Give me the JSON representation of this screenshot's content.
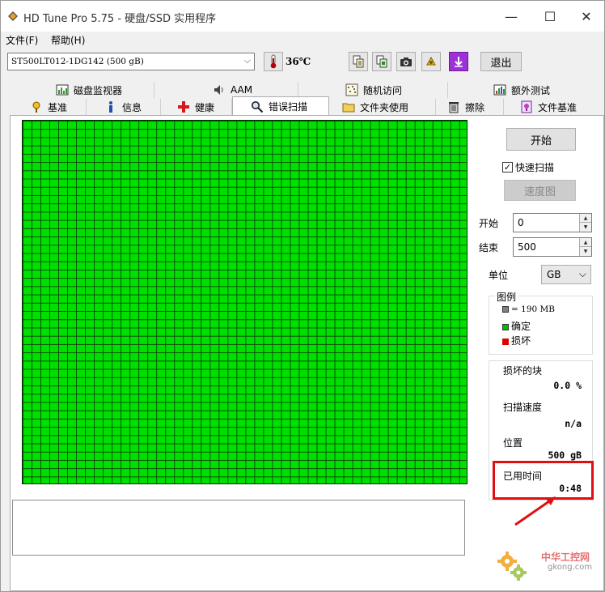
{
  "app": {
    "title": "HD Tune Pro 5.75 - 硬盘/SSD 实用程序",
    "minimize_glyph": "—",
    "maximize_glyph": "☐",
    "close_glyph": "✕"
  },
  "menu": {
    "items": [
      {
        "label": "文件(F)"
      },
      {
        "label": "帮助(H)"
      }
    ]
  },
  "toolbar": {
    "drive": "ST500LT012-1DG142 (500 gB)",
    "temperature": "36℃",
    "exit_label": "退出",
    "icons": [
      "copy-text-icon",
      "copy-image-icon",
      "camera-icon",
      "options-icon",
      "save-icon"
    ],
    "colors": {
      "save_icon": "#9c31d6",
      "thermometer": "#c00000"
    }
  },
  "tabs": {
    "row_top": [
      {
        "label": "磁盘监视器",
        "icon": "disk-monitor-icon"
      },
      {
        "label": "AAM",
        "icon": "speaker-icon"
      },
      {
        "label": "随机访问",
        "icon": "random-access-icon"
      },
      {
        "label": "额外测试",
        "icon": "extra-tests-icon"
      }
    ],
    "row_bottom": [
      {
        "label": "基准",
        "icon": "benchmark-icon"
      },
      {
        "label": "信息",
        "icon": "info-icon"
      },
      {
        "label": "健康",
        "icon": "health-icon"
      },
      {
        "label": "错误扫描",
        "icon": "magnifier-icon",
        "active": true
      },
      {
        "label": "文件夹使用",
        "icon": "folder-icon"
      },
      {
        "label": "擦除",
        "icon": "trash-icon"
      },
      {
        "label": "文件基准",
        "icon": "file-benchmark-icon"
      }
    ]
  },
  "scan": {
    "grid_color": "#00e000",
    "grid_line_color": "#0b4b0b",
    "start_button": "开始",
    "quick_scan_label": "快速扫描",
    "quick_scan_checked": true,
    "speed_map_button": "速度图",
    "start_label": "开始",
    "start_value": "0",
    "end_label": "结束",
    "end_value": "500",
    "unit_label": "单位",
    "unit_value": "GB"
  },
  "legend": {
    "title": "图例",
    "block_size": "= 190 MB",
    "ok_label": "确定",
    "bad_label": "损坏",
    "colors": {
      "block": "#808080",
      "ok": "#00c000",
      "bad": "#e00000"
    }
  },
  "stats": {
    "damaged_label": "损坏的块",
    "damaged_value": "0.0 %",
    "speed_label": "扫描速度",
    "speed_value": "n/a",
    "position_label": "位置",
    "position_value": "500 gB",
    "elapsed_label": "已用时间",
    "elapsed_value": "0:48"
  },
  "watermark": {
    "text_cn": "中华工控网",
    "text_en": "gkong.com"
  }
}
